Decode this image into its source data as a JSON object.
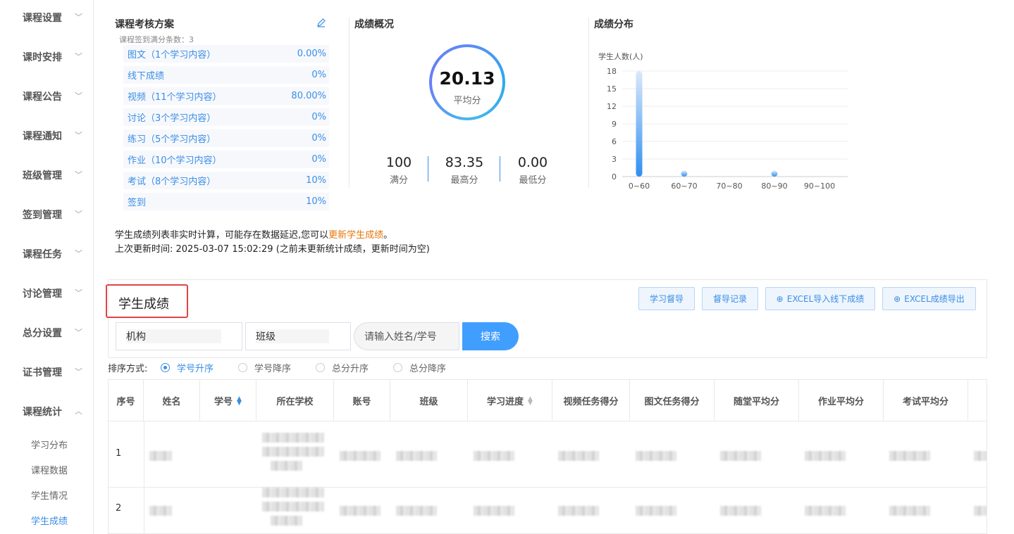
{
  "sidebar": {
    "groups": [
      {
        "label": "课程设置",
        "chevron": "chevron-down"
      },
      {
        "label": "课时安排",
        "chevron": "chevron-down"
      },
      {
        "label": "课程公告",
        "chevron": "chevron-down"
      },
      {
        "label": "课程通知",
        "chevron": "chevron-down"
      },
      {
        "label": "班级管理",
        "chevron": "chevron-down"
      },
      {
        "label": "签到管理",
        "chevron": "chevron-down"
      },
      {
        "label": "课程任务",
        "chevron": "chevron-down"
      },
      {
        "label": "讨论管理",
        "chevron": "chevron-down"
      },
      {
        "label": "总分设置",
        "chevron": "chevron-down"
      },
      {
        "label": "证书管理",
        "chevron": "chevron-down"
      },
      {
        "label": "课程统计",
        "chevron": "chevron-up"
      }
    ],
    "subitems": [
      "学习分布",
      "课程数据",
      "学生情况",
      "学生成绩"
    ],
    "active_subitem": "学生成绩"
  },
  "scheme": {
    "title": "课程考核方案",
    "subtitle": "课程签到满分条数：3",
    "rows": [
      {
        "name": "图文",
        "detail": "（1个学习内容）",
        "pct": "0.00%"
      },
      {
        "name": "线下成绩",
        "detail": "",
        "pct": "0%"
      },
      {
        "name": "视频",
        "detail": "（11个学习内容）",
        "pct": "80.00%"
      },
      {
        "name": "讨论",
        "detail": "（3个学习内容）",
        "pct": "0%"
      },
      {
        "name": "练习",
        "detail": "（5个学习内容）",
        "pct": "0%"
      },
      {
        "name": "作业",
        "detail": "（10个学习内容）",
        "pct": "0%"
      },
      {
        "name": "考试",
        "detail": "（8个学习内容）",
        "pct": "10%"
      },
      {
        "name": "签到",
        "detail": "",
        "pct": "10%"
      }
    ]
  },
  "overview": {
    "title": "成绩概况",
    "average": "20.13",
    "average_label": "平均分",
    "stats": [
      {
        "value": "100",
        "label": "满分"
      },
      {
        "value": "83.35",
        "label": "最高分"
      },
      {
        "value": "0.00",
        "label": "最低分"
      }
    ]
  },
  "distribution": {
    "title": "成绩分布",
    "chart_data": {
      "type": "bar",
      "ylabel": "学生人数(人)",
      "categories": [
        "0~60",
        "60~70",
        "70~80",
        "80~90",
        "90~100"
      ],
      "values": [
        18,
        1,
        0,
        1,
        0
      ],
      "ylim": [
        0,
        18
      ],
      "yticks": [
        0,
        3,
        6,
        9,
        12,
        15,
        18
      ],
      "grid": true
    }
  },
  "notice": {
    "line1_prefix": "学生成绩列表非实时计算，可能存在数据延迟,您可以",
    "line1_link": "更新学生成绩",
    "line1_suffix": "。",
    "line2": "上次更新时间: 2025-03-07 15:02:29 (之前未更新统计成绩，更新时间为空)"
  },
  "grades": {
    "title": "学生成绩",
    "buttons": [
      "学习督导",
      "督导记录",
      "EXCEL导入线下成绩",
      "EXCEL成绩导出"
    ],
    "filters": {
      "org": "机构",
      "class": "班级",
      "search_placeholder": "请输入姓名/学号",
      "search_button": "搜索"
    },
    "sort": {
      "label": "排序方式:",
      "options": [
        "学号升序",
        "学号降序",
        "总分升序",
        "总分降序"
      ],
      "selected": "学号升序"
    },
    "columns": [
      "序号",
      "姓名",
      "学号",
      "所在学校",
      "账号",
      "班级",
      "学习进度",
      "视频任务得分",
      "图文任务得分",
      "随堂平均分",
      "作业平均分",
      "考试平均分"
    ],
    "rows": [
      {
        "index": "1"
      },
      {
        "index": "2"
      }
    ]
  },
  "colors": {
    "accent": "#3a8ee6",
    "link_orange": "#e6760a",
    "highlight_red": "#e04545"
  }
}
